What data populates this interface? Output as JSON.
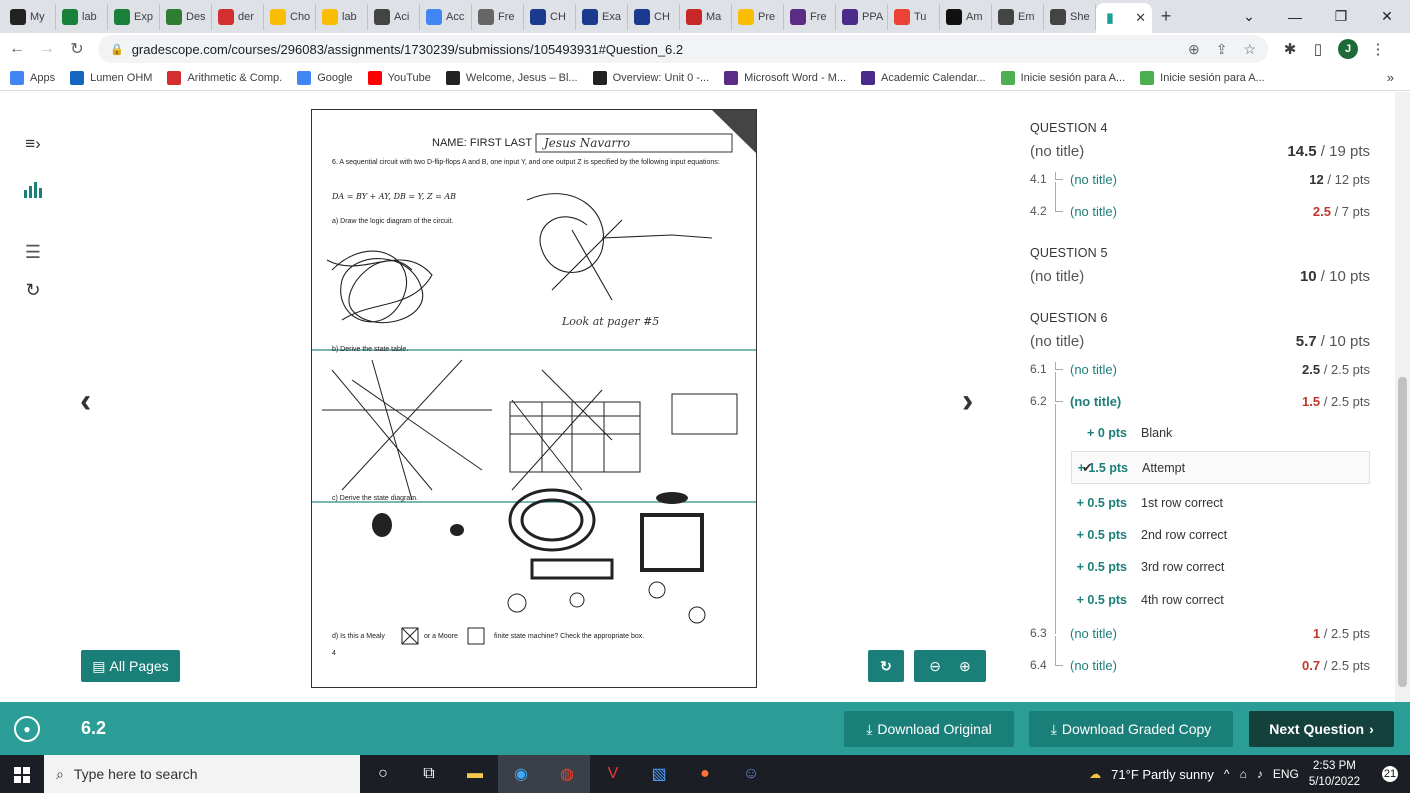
{
  "browser": {
    "tabs": [
      {
        "label": "My",
        "icon": "blackboard",
        "color": "#222"
      },
      {
        "label": "lab",
        "icon": "sheets",
        "color": "#188038"
      },
      {
        "label": "Exp",
        "icon": "sheets",
        "color": "#188038"
      },
      {
        "label": "Des",
        "icon": "desmos",
        "color": "#2f7d32"
      },
      {
        "label": "der",
        "icon": "symbolab",
        "color": "#d32f2f"
      },
      {
        "label": "Cho",
        "icon": "drive",
        "color": "#fbbc04"
      },
      {
        "label": "lab",
        "icon": "slides",
        "color": "#fbbc04"
      },
      {
        "label": "Aci",
        "icon": "chatgpt",
        "color": "#444"
      },
      {
        "label": "Acc",
        "icon": "google",
        "color": "#4285f4"
      },
      {
        "label": "Fre",
        "icon": "pen",
        "color": "#666"
      },
      {
        "label": "CH",
        "icon": "star",
        "color": "#1a3a8f"
      },
      {
        "label": "Exa",
        "icon": "star",
        "color": "#1a3a8f"
      },
      {
        "label": "CH",
        "icon": "star",
        "color": "#1a3a8f"
      },
      {
        "label": "Ma",
        "icon": "m-red",
        "color": "#c62828"
      },
      {
        "label": "Pre",
        "icon": "slides",
        "color": "#fbbc04"
      },
      {
        "label": "Fre",
        "icon": "word",
        "color": "#5b2c86"
      },
      {
        "label": "PPA",
        "icon": "h",
        "color": "#4a2a8a"
      },
      {
        "label": "Tu",
        "icon": "gmail",
        "color": "#ea4335"
      },
      {
        "label": "Am",
        "icon": "amazon",
        "color": "#111"
      },
      {
        "label": "Em",
        "icon": "chatgpt",
        "color": "#444"
      },
      {
        "label": "She",
        "icon": "chatgpt",
        "color": "#444"
      }
    ],
    "active_tab_icon": "gradescope-bars",
    "url": "gradescope.com/courses/296083/assignments/1730239/submissions/105493931#Question_6.2",
    "profile_initial": "J",
    "bookmarks": [
      {
        "label": "Apps",
        "icon": "apps-grid",
        "color": "#4285f4"
      },
      {
        "label": "Lumen OHM",
        "icon": "omega",
        "color": "#1565c0"
      },
      {
        "label": "Arithmetic & Comp.",
        "icon": "Sy",
        "color": "#d32f2f"
      },
      {
        "label": "Google",
        "icon": "G",
        "color": "#4285f4"
      },
      {
        "label": "YouTube",
        "icon": "play",
        "color": "#ff0000"
      },
      {
        "label": "Welcome, Jesus – Bl...",
        "icon": "Bb",
        "color": "#222"
      },
      {
        "label": "Overview: Unit 0 -...",
        "icon": "C",
        "color": "#222"
      },
      {
        "label": "Microsoft Word - M...",
        "icon": "word",
        "color": "#5b2c86"
      },
      {
        "label": "Academic Calendar...",
        "icon": "H",
        "color": "#4a2a8a"
      },
      {
        "label": "Inicie sesión para A...",
        "icon": "leaf",
        "color": "#4caf50"
      },
      {
        "label": "Inicie sesión para A...",
        "icon": "leaf",
        "color": "#4caf50"
      }
    ]
  },
  "scan": {
    "name_label": "NAME: FIRST LAST",
    "name_written": "Jesus Navarro",
    "q6_text": "6. A sequential circuit with two D-flip-flops A and B, one input Y, and one output Z is specified by the following input equations:",
    "equations": "DA = BY + AY,   DB = Y,   Z = AB",
    "part_a": "a) Draw the logic diagram of the circuit.",
    "part_b": "b) Derive the state table.",
    "part_c": "c) Derive the state diagram.",
    "part_d": "d) Is this a Mealy",
    "part_d2": "or a Moore",
    "part_d3": "finite state machine? Check the appropriate box.",
    "handwriting_note": "Look at pager #5",
    "page_number": "4"
  },
  "viewer": {
    "all_pages_label": "All Pages"
  },
  "rubric": {
    "questions": [
      {
        "head": "QUESTION 4",
        "title": "(no title)",
        "score": "14.5",
        "total": "/ 19 pts"
      },
      {
        "head": "QUESTION 5",
        "title": "(no title)",
        "score": "10",
        "total": "/ 10 pts"
      },
      {
        "head": "QUESTION 6",
        "title": "(no title)",
        "score": "5.7",
        "total": "/ 10 pts"
      }
    ],
    "subs": [
      {
        "num": "4.1",
        "title": "(no title)",
        "score": "12",
        "total": "/ 12 pts",
        "red": false
      },
      {
        "num": "4.2",
        "title": "(no title)",
        "score": "2.5",
        "total": "/ 7 pts",
        "red": true
      },
      {
        "num": "6.1",
        "title": "(no title)",
        "score": "2.5",
        "total": "/ 2.5 pts",
        "red": false
      },
      {
        "num": "6.2",
        "title": "(no title)",
        "score": "1.5",
        "total": "/ 2.5 pts",
        "red": true
      },
      {
        "num": "6.3",
        "title": "(no title)",
        "score": "1",
        "total": "/ 2.5 pts",
        "red": true
      },
      {
        "num": "6.4",
        "title": "(no title)",
        "score": "0.7",
        "total": "/ 2.5 pts",
        "red": true
      }
    ],
    "items": [
      {
        "pts": "+ 0 pts",
        "label": "Blank",
        "selected": false
      },
      {
        "pts": "+ 1.5 pts",
        "label": "Attempt",
        "selected": true
      },
      {
        "pts": "+ 0.5 pts",
        "label": "1st row correct",
        "selected": false
      },
      {
        "pts": "+ 0.5 pts",
        "label": "2nd row correct",
        "selected": false
      },
      {
        "pts": "+ 0.5 pts",
        "label": "3rd row correct",
        "selected": false
      },
      {
        "pts": "+ 0.5 pts",
        "label": "4th row correct",
        "selected": false
      }
    ]
  },
  "footer": {
    "question_number": "6.2",
    "download_original": "Download Original",
    "download_graded": "Download Graded Copy",
    "next_question": "Next Question"
  },
  "taskbar": {
    "search_placeholder": "Type here to search",
    "weather": "71°F  Partly sunny",
    "lang": "ENG",
    "time": "2:53 PM",
    "date": "5/10/2022",
    "notifications": "21"
  },
  "colors": {
    "accent": "#1b7f79",
    "footer": "#2a9d96",
    "score_red": "#c0392b"
  }
}
